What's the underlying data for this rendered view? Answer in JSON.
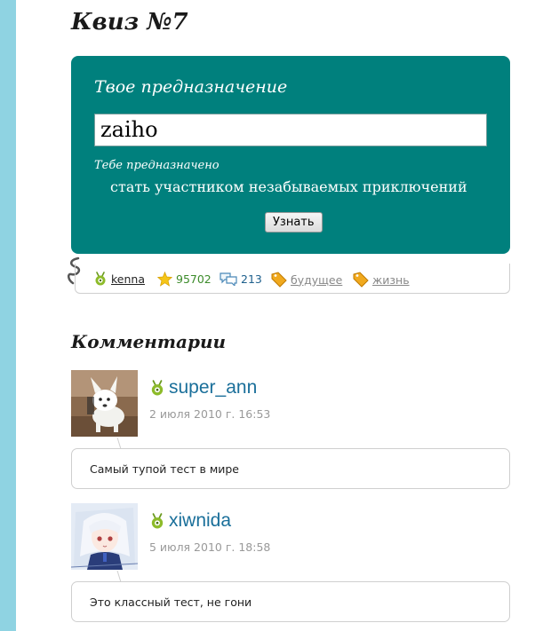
{
  "quiz": {
    "title": "Квиз №7",
    "question": "Твое предназначение",
    "input_value": "zaiho",
    "result_label": "Тебе предназначено",
    "result_text": "стать участником незабываемых приключений",
    "button_label": "Узнать"
  },
  "meta": {
    "author": "kenna",
    "rating": "95702",
    "comments_count": "213",
    "tags": [
      "будущее",
      "жизнь"
    ]
  },
  "comments_section": {
    "heading": "Комментарии",
    "items": [
      {
        "user": "super_ann",
        "date": "2 июля 2010 г. 16:53",
        "text": "Самый тупой тест в мире"
      },
      {
        "user": "xiwnida",
        "date": "5 июля 2010 г. 18:58",
        "text": "Это классный тест, не гони"
      }
    ]
  },
  "colors": {
    "accent": "#00807d",
    "sidebar": "#8fd3e2",
    "username": "#1a6f9a",
    "rating": "#3c8b2a"
  }
}
